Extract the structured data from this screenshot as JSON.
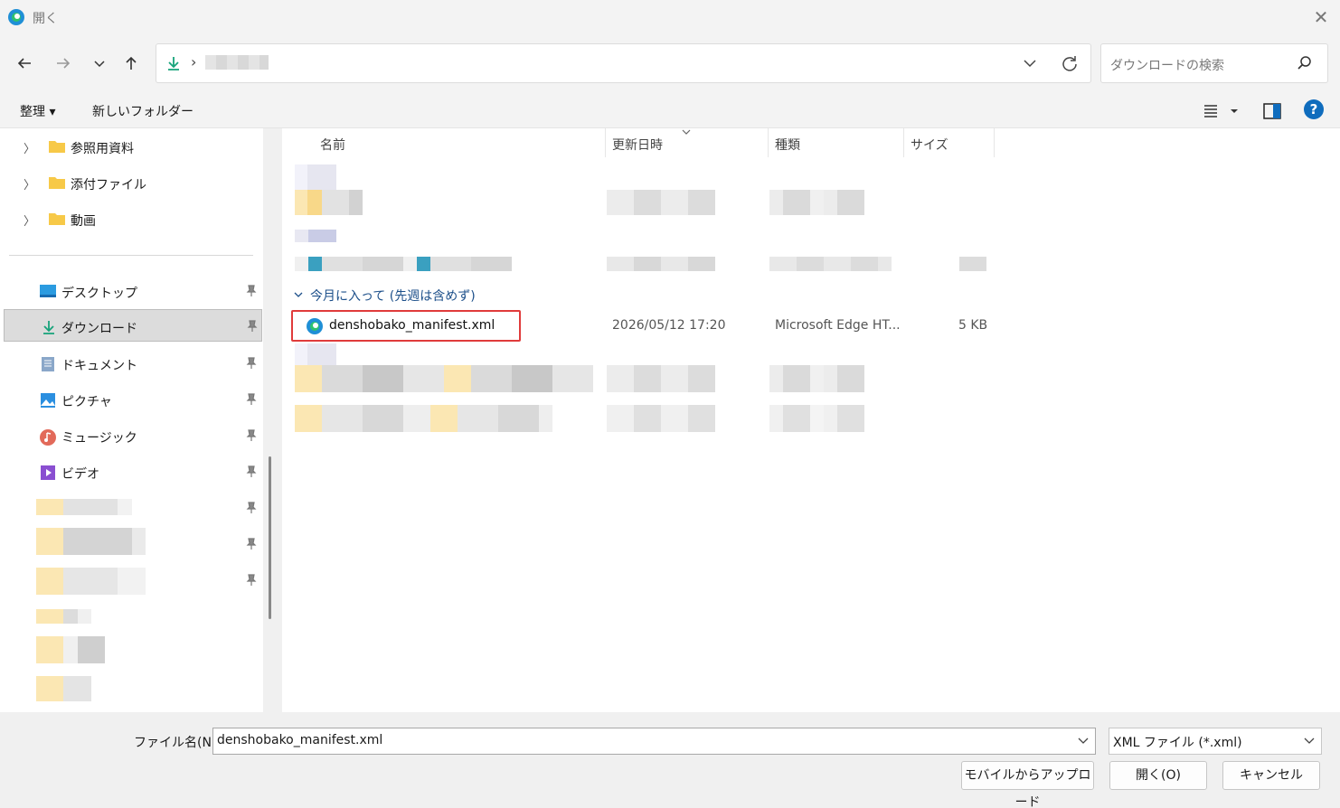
{
  "window": {
    "title": "開く"
  },
  "address": {
    "separator": "›"
  },
  "search": {
    "placeholder": "ダウンロードの検索"
  },
  "toolbar": {
    "organize": "整理 ▾",
    "new_folder": "新しいフォルダー",
    "help": "?"
  },
  "sidebar": {
    "tree": [
      {
        "label": "参照用資料"
      },
      {
        "label": "添付ファイル"
      },
      {
        "label": "動画"
      }
    ],
    "quick": [
      {
        "label": "デスクトップ"
      },
      {
        "label": "ダウンロード"
      },
      {
        "label": "ドキュメント"
      },
      {
        "label": "ピクチャ"
      },
      {
        "label": "ミュージック"
      },
      {
        "label": "ビデオ"
      }
    ]
  },
  "columns": {
    "name": "名前",
    "date": "更新日時",
    "type": "種類",
    "size": "サイズ"
  },
  "group": {
    "label": "今月に入って (先週は含めず)"
  },
  "file": {
    "name": "denshobako_manifest.xml",
    "date": "2026/05/12 17:20",
    "type": "Microsoft Edge HT...",
    "size": "5 KB"
  },
  "bottom": {
    "filename_label": "ファイル名(N):",
    "filename_value": "denshobako_manifest.xml",
    "filter": "XML ファイル (*.xml)",
    "mobile_button": "モバイルからアップロード",
    "open_button": "開く(O)",
    "cancel_button": "キャンセル"
  },
  "colors": {
    "accent": "#0f6cbd",
    "highlight": "#e03b3b",
    "folder": "#f7c948"
  }
}
